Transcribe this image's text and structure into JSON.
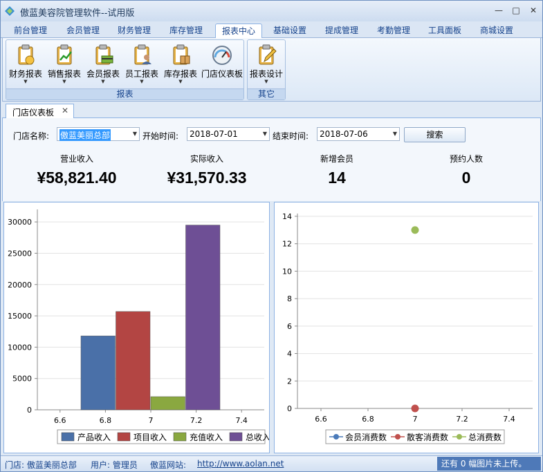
{
  "window": {
    "title": "傲蓝美容院管理软件--试用版",
    "minimize": "—",
    "maximize": "□",
    "close": "✕"
  },
  "menu": [
    "前台管理",
    "会员管理",
    "财务管理",
    "库存管理",
    "报表中心",
    "基础设置",
    "提成管理",
    "考勤管理",
    "工具面板",
    "商城设置"
  ],
  "menu_active": "报表中心",
  "ribbon": {
    "groups": [
      {
        "caption": "报表",
        "buttons": [
          "财务报表",
          "销售报表",
          "会员报表",
          "员工报表",
          "库存报表",
          "门店仪表板"
        ]
      },
      {
        "caption": "其它",
        "buttons": [
          "报表设计"
        ]
      }
    ]
  },
  "doc_tab": {
    "label": "门店仪表板",
    "close": "✕"
  },
  "filter": {
    "store_label": "门店名称:",
    "store_value": "傲蓝美丽总部",
    "start_label": "开始时间:",
    "start_value": "2018-07-01",
    "end_label": "结束时间:",
    "end_value": "2018-07-06",
    "search": "搜索"
  },
  "stats": [
    {
      "label": "营业收入",
      "value": "¥58,821.40"
    },
    {
      "label": "实际收入",
      "value": "¥31,570.33"
    },
    {
      "label": "新增会员",
      "value": "14"
    },
    {
      "label": "预约人数",
      "value": "0"
    }
  ],
  "chart_data": [
    {
      "type": "bar",
      "x_ticks": [
        "6.6",
        "6.8",
        "7",
        "7.2",
        "7.4"
      ],
      "y_ticks": [
        "0",
        "5000",
        "10000",
        "15000",
        "20000",
        "25000",
        "30000"
      ],
      "xlim": [
        6.5,
        7.5
      ],
      "ylim": [
        0,
        32000
      ],
      "x": 7,
      "series": [
        {
          "name": "产品收入",
          "value": 11800,
          "color": "#4a70a8"
        },
        {
          "name": "项目收入",
          "value": 15700,
          "color": "#b34543"
        },
        {
          "name": "充值收入",
          "value": 2100,
          "color": "#8aa840"
        },
        {
          "name": "总收入",
          "value": 29500,
          "color": "#6e4f95"
        }
      ]
    },
    {
      "type": "scatter",
      "x_ticks": [
        "6.6",
        "6.8",
        "7",
        "7.2",
        "7.4"
      ],
      "y_ticks": [
        "0",
        "2",
        "4",
        "6",
        "8",
        "10",
        "12",
        "14"
      ],
      "xlim": [
        6.5,
        7.5
      ],
      "ylim": [
        0,
        14.2
      ],
      "series": [
        {
          "name": "会员消费数",
          "x": 7,
          "y": 0,
          "color": "#4a7ab9",
          "visible": false
        },
        {
          "name": "散客消费数",
          "x": 7,
          "y": 0,
          "color": "#c0504d",
          "visible": true
        },
        {
          "name": "总消费数",
          "x": 7,
          "y": 13,
          "color": "#9bbb59",
          "visible": true
        }
      ]
    }
  ],
  "status": {
    "store": "门店: 傲蓝美丽总部",
    "user": "用户: 管理员",
    "site_label": "傲蓝网站:",
    "site_url": "http://www.aolan.net",
    "upload": "还有 0 幅图片未上传。"
  }
}
